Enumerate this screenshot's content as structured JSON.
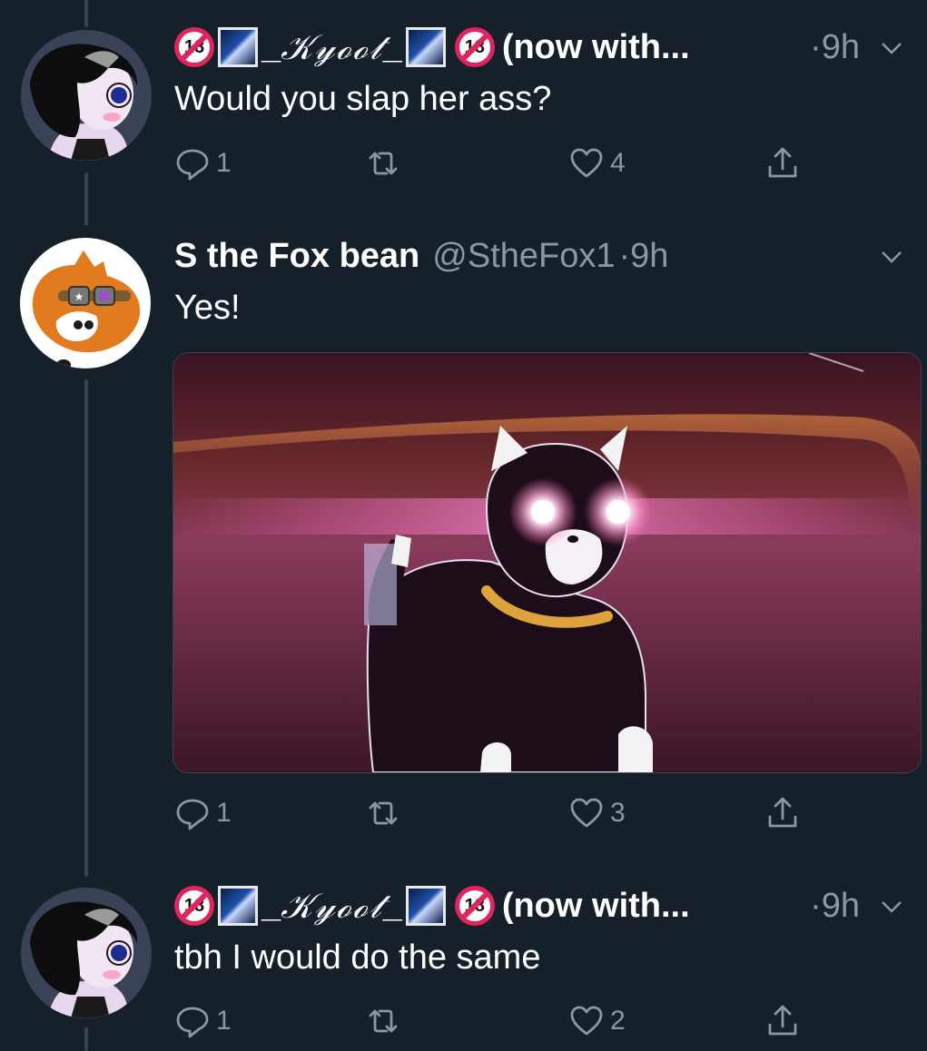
{
  "tweets": [
    {
      "name_prefix": "_",
      "name_styled": "𝒦𝓎ℴℴ𝓉",
      "name_suffix": "_",
      "name_tail": "(now with...",
      "time": "·9h",
      "text": "Would you slap her ass?",
      "reply_count": "1",
      "retweet_count": "",
      "like_count": "4"
    },
    {
      "name": "S the Fox bean",
      "handle": "@StheFox1",
      "time": "·9h",
      "text": "Yes!",
      "reply_count": "1",
      "retweet_count": "",
      "like_count": "3"
    },
    {
      "name_prefix": "_",
      "name_styled": "𝒦𝓎ℴℴ𝓉",
      "name_suffix": "_",
      "name_tail": "(now with...",
      "time": "·9h",
      "text": "tbh I would do the same",
      "reply_count": "1",
      "retweet_count": "",
      "like_count": "2"
    }
  ],
  "badge_text": "18",
  "colors": {
    "background": "#15202b",
    "muted": "#8899a6",
    "thread_line": "#38444d",
    "badge": "#e0245e"
  },
  "icons": [
    "reply-icon",
    "retweet-icon",
    "like-icon",
    "share-icon",
    "chevron-down-icon",
    "no-under-18-icon",
    "sparkle-image-icon"
  ]
}
